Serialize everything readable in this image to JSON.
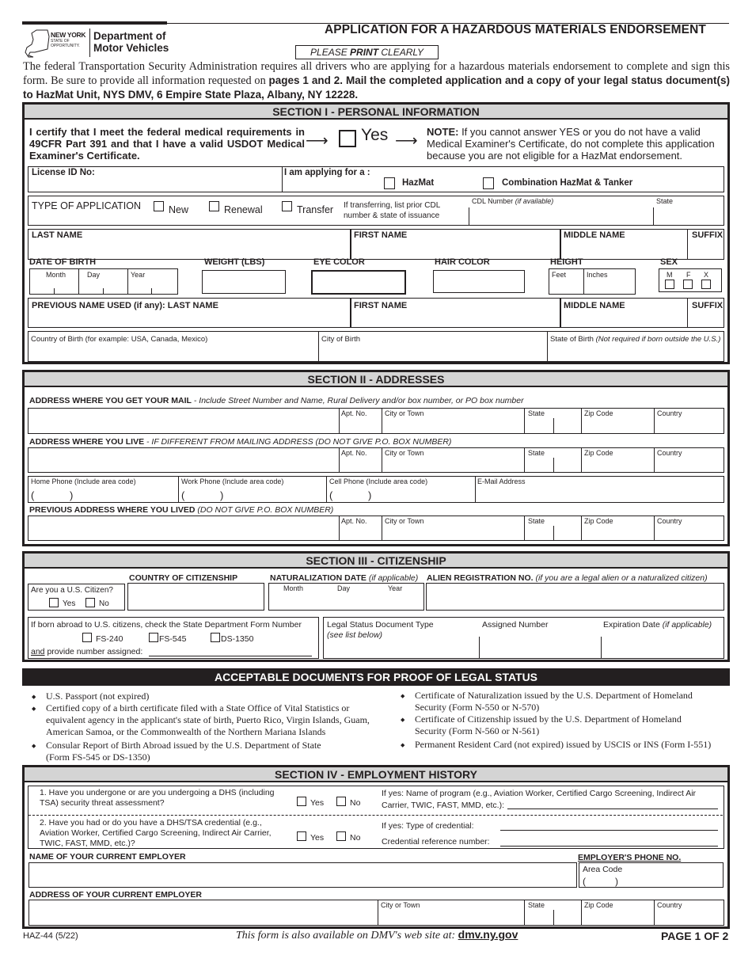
{
  "header": {
    "logo": {
      "state_name": "NEW YORK",
      "state_tagline_1": "STATE OF",
      "state_tagline_2": "OPPORTUNITY.",
      "agency_line1": "Department of",
      "agency_line2": "Motor Vehicles",
      "icon": "ny-state-map-icon"
    },
    "title": "APPLICATION FOR A HAZARDOUS MATERIALS ENDORSEMENT",
    "print_notice": {
      "pre": "PLEASE ",
      "bold": "PRINT",
      "post": " CLEARLY"
    },
    "intro_plain": "The federal Transportation Security Administration requires all drivers who are applying for a hazardous materials endorsement to complete and sign this form. Be sure to provide all information requested on ",
    "intro_bold": "pages 1 and 2. Mail the completed application and a copy of your legal status document(s) to HazMat Unit, NYS DMV, 6 Empire State Plaza, Albany, NY  12228."
  },
  "section1": {
    "title": "SECTION I - PERSONAL INFORMATION",
    "certify_text": "I certify that I meet the federal medical requirements in 49CFR Part 391 and that I have a valid USDOT Medical Examiner's Certificate.",
    "yes_label": "Yes",
    "note_bold": "NOTE:",
    "note_text": " If you cannot answer YES or you do not have a valid Medical Examiner's Certificate, do not complete this application because you are not eligible for a HazMat endorsement.",
    "license_label": "License  ID No:",
    "applying_label": "I am applying for a :",
    "applying_options": [
      "HazMat",
      "Combination HazMat & Tanker"
    ],
    "type_label": "TYPE OF APPLICATION",
    "type_options": [
      "New",
      "Renewal",
      "Transfer"
    ],
    "transfer_note": "If transferring, list prior CDL number & state of issuance",
    "cdl_label": "CDL Number",
    "cdl_note": "(if available)",
    "state_label": "State",
    "last_name": "LAST NAME",
    "first_name": "FIRST NAME",
    "middle_name": "MIDDLE NAME",
    "suffix": "SUFFIX",
    "dob_label": "DATE OF BIRTH",
    "dob_parts": [
      "Month",
      "Day",
      "Year"
    ],
    "weight_label": "WEIGHT (LBS)",
    "eye_label": "EYE COLOR",
    "hair_label": "HAIR COLOR",
    "height_label": "HEIGHT",
    "height_parts": [
      "Feet",
      "Inches"
    ],
    "sex_label": "SEX",
    "sex_options": [
      "M",
      "F",
      "X"
    ],
    "prev_name_label": "PREVIOUS NAME USED (if any): LAST NAME",
    "country_birth": "Country of Birth (for example: USA, Canada, Mexico)",
    "city_birth": "City of Birth",
    "state_birth": "State of Birth ",
    "state_birth_note": "(Not required if born outside the U.S.)"
  },
  "section2": {
    "title": "SECTION II - ADDRESSES",
    "mail_label": "ADDRESS WHERE YOU GET YOUR MAIL",
    "mail_note": " - Include Street Number and Name, Rural Delivery and/or box number, or PO box number",
    "live_label": "ADDRESS WHERE YOU LIVE",
    "live_note": " - IF DIFFERENT FROM MAILING ADDRESS (DO NOT GIVE P.O. BOX NUMBER)",
    "prev_label": "PREVIOUS ADDRESS WHERE YOU LIVED",
    "prev_note": " (DO NOT GIVE P.O. BOX NUMBER)",
    "cols": {
      "apt": "Apt. No.",
      "city": "City or Town",
      "state": "State",
      "zip": "Zip Code",
      "country": "Country"
    },
    "phones": [
      "Home Phone (Include area code)",
      "Work Phone (Include area code)",
      "Cell Phone (Include area code)",
      "E-Mail Address"
    ],
    "paren_open": "(",
    "paren_close": ")"
  },
  "section3": {
    "title": "SECTION III - CITIZENSHIP",
    "country_label": "COUNTRY OF CITIZENSHIP",
    "nat_label": "NATURALIZATION DATE",
    "nat_note": " (if applicable)",
    "alien_label": "ALIEN REGISTRATION NO.",
    "alien_note": " (if you are a legal alien or a naturalized citizen)",
    "citizen_q": "Are you a U.S. Citizen?",
    "yes": "Yes",
    "no": "No",
    "date_parts": [
      "Month",
      "Day",
      "Year"
    ],
    "abroad_text": "If born abroad to U.S. citizens, check the State Department Form Number",
    "forms": [
      "FS-240",
      "FS-545",
      "DS-1350"
    ],
    "and_word": "and",
    "assigned_text": " provide number assigned:",
    "legal_doc_label": "Legal Status Document Type",
    "legal_doc_note": "(see list below)",
    "assigned_number": "Assigned Number",
    "expiration": "Expiration Date ",
    "expiration_note": "(if applicable)"
  },
  "documents": {
    "title": "ACCEPTABLE DOCUMENTS FOR PROOF OF LEGAL STATUS",
    "left": [
      "U.S. Passport (not expired)",
      "Certified copy of a birth certificate filed with a State Office of Vital Statistics or equivalent agency in the applicant's state of birth, Puerto Rico, Virgin Islands, Guam, American Samoa, or the Commonwealth of the Northern Mariana Islands",
      "Consular Report of Birth Abroad issued by the U.S. Department of State (Form FS-545 or DS-1350)"
    ],
    "right": [
      "Certificate of Naturalization issued by the U.S. Department of Homeland Security (Form N-550 or N-570)",
      "Certificate of Citizenship issued by the U.S. Department of Homeland Security (Form N-560 or N-561)",
      "Permanent Resident Card (not expired) issued by USCIS or INS (Form I-551)"
    ]
  },
  "section4": {
    "title": "SECTION IV - EMPLOYMENT HISTORY",
    "q1": "1.  Have you undergone or are you undergoing a DHS (including TSA) security threat assessment?",
    "q1_ifyes": "If yes:  Name of program (e.g., Aviation Worker, Certified Cargo Screening, Indirect Air Carrier, TWIC, FAST, MMD, etc.):",
    "q2": "2.  Have you had or do you have a DHS/TSA credential (e.g., Aviation Worker, Certified Cargo Screening, Indirect Air Carrier, TWIC, FAST, MMD, etc.)?",
    "q2_type": "If yes:  Type of credential:",
    "q2_ref": "Credential reference number:",
    "yes": "Yes",
    "no": "No",
    "employer_name": "NAME OF YOUR CURRENT EMPLOYER",
    "employer_phone": "EMPLOYER'S PHONE NO.",
    "area_code": "Area Code",
    "employer_address": "ADDRESS OF YOUR CURRENT EMPLOYER",
    "cols": {
      "city": "City or Town",
      "state": "State",
      "zip": "Zip Code",
      "country": "Country"
    }
  },
  "footer": {
    "form_id": "HAZ-44 (5/22)",
    "web_text": "This form is also available on DMV's web site at: ",
    "web_link": "dmv.ny.gov",
    "page": "PAGE 1 OF 2"
  }
}
